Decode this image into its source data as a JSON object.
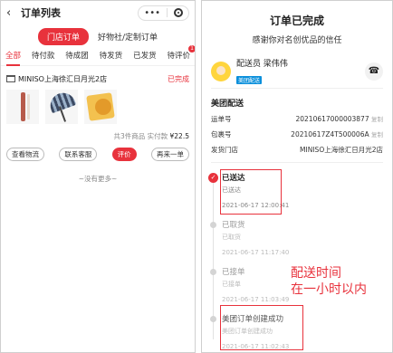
{
  "left": {
    "nav": {
      "back_icon": "chevron-left-icon",
      "title": "订单列表",
      "more_icon": "more-dots-icon",
      "target_icon": "target-icon"
    },
    "segments": [
      {
        "label": "门店订单",
        "active": true
      },
      {
        "label": "好物社/定制订单",
        "active": false
      }
    ],
    "tabs": [
      {
        "label": "全部",
        "active": true
      },
      {
        "label": "待付款"
      },
      {
        "label": "待成团"
      },
      {
        "label": "待发货"
      },
      {
        "label": "已发货"
      },
      {
        "label": "待评价",
        "badge": "1"
      }
    ],
    "order": {
      "store": "MINISO上海徐汇日月光2店",
      "status": "已完成",
      "summary_prefix": "共3件商品 实付款",
      "amount": "¥22.5",
      "buttons": [
        "查看物流",
        "联系客服",
        "评价",
        "再来一单"
      ]
    },
    "footer": "~没有更多~"
  },
  "right": {
    "title": "订单已完成",
    "subtitle": "感谢你对名创优品的信任",
    "courier": {
      "role": "配送员",
      "name": "梁伟伟",
      "tag": "美团配送"
    },
    "delivery_title": "美团配送",
    "rows": [
      {
        "key": "运单号",
        "value": "20210617000003877",
        "copy": "复制"
      },
      {
        "key": "包裹号",
        "value": "20210617Z4T500006A",
        "copy": "复制"
      },
      {
        "key": "发货门店",
        "value": "MINISO上海徐汇日月光2店",
        "copy": ""
      }
    ],
    "timeline": [
      {
        "title": "已送达",
        "desc": "已送达",
        "time": "2021-06-17 12:00:41"
      },
      {
        "title": "已取货",
        "desc": "已取货",
        "time": "2021-06-17 11:17:40"
      },
      {
        "title": "已接单",
        "desc": "已接单",
        "time": "2021-06-17 11:03:49"
      },
      {
        "title": "美团订单创建成功",
        "desc": "美团订单创建成功",
        "time": "2021-06-17 11:02:43"
      }
    ],
    "note_line1": "配送时间",
    "note_line2": "在一小时以内"
  },
  "colors": {
    "accent": "#e8323c",
    "muted": "#999999",
    "meituan_blue": "#0a8fdb"
  }
}
